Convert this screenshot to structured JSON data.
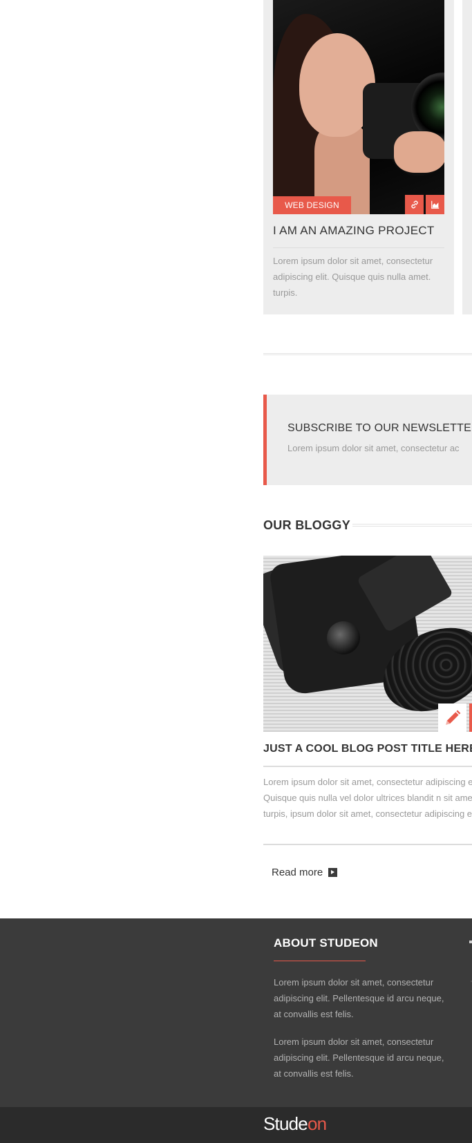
{
  "portfolio": {
    "category": "WEB DESIGN",
    "title": "I AM AN AMAZING PROJECT",
    "description": "Lorem ipsum dolor sit amet, consectetur adipiscing elit. Quisque quis nulla amet. turpis.",
    "icons": {
      "link": "link-icon",
      "stats": "area-chart-icon"
    }
  },
  "newsletter": {
    "title": "SUBSCRIBE TO OUR NEWSLETTER. W",
    "text": "Lorem ipsum dolor sit amet, consectetur ac"
  },
  "blog": {
    "section_title": "OUR BLOGGY",
    "post_title": "JUST A COOL BLOG POST TITLE HERE.",
    "excerpt": "Lorem ipsum dolor sit amet, consectetur adipiscing elit. Quisque quis nulla vel dolor ultrices blandit n sit amet. turpis, ipsum dolor sit amet, consectetur adipiscing elit.",
    "read_more": "Read more",
    "edit_icon": "pencil-icon"
  },
  "footer": {
    "heading": "ABOUT STUDEON",
    "paragraph_1": "Lorem ipsum dolor sit amet, consectetur adipiscing elit. Pellentesque id arcu neque, at convallis est felis.",
    "paragraph_2": "Lorem ipsum dolor sit amet, consectetur adipiscing elit. Pellentesque id arcu neque, at convallis est felis.",
    "logo_main": "Stude",
    "logo_accent": "on"
  },
  "colors": {
    "accent": "#e8594a",
    "card_bg": "#ededed",
    "footer_bg": "#3b3b3b",
    "bottom_bar_bg": "#2b2b2b"
  }
}
